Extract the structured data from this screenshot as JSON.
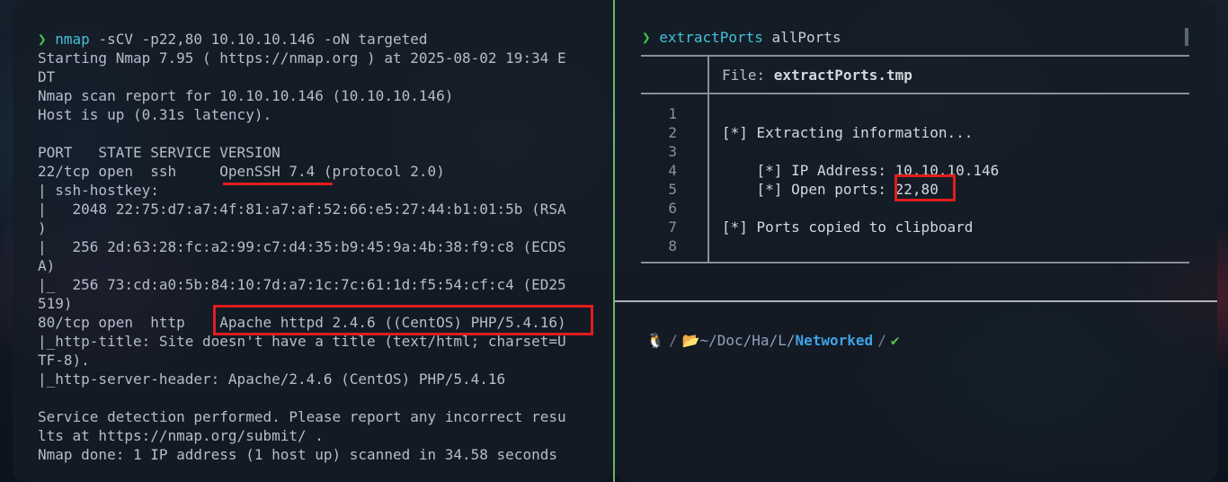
{
  "left_terminal": {
    "prompt_symbol": "❯",
    "command": "nmap",
    "args": " -sCV -p22,80 10.10.10.146 -oN targeted",
    "output_lines": [
      "Starting Nmap 7.95 ( https://nmap.org ) at 2025-08-02 19:34 E",
      "DT",
      "Nmap scan report for 10.10.10.146 (10.10.10.146)",
      "Host is up (0.31s latency).",
      "",
      "PORT   STATE SERVICE VERSION",
      "22/tcp open  ssh     OpenSSH 7.4 (protocol 2.0)",
      "| ssh-hostkey:",
      "|   2048 22:75:d7:a7:4f:81:a7:af:52:66:e5:27:44:b1:01:5b (RSA",
      ")",
      "|   256 2d:63:28:fc:a2:99:c7:d4:35:b9:45:9a:4b:38:f9:c8 (ECDS",
      "A)",
      "|_  256 73:cd:a0:5b:84:10:7d:a7:1c:7c:61:1d:f5:54:cf:c4 (ED25",
      "519)",
      "80/tcp open  http    Apache httpd 2.4.6 ((CentOS) PHP/5.4.16)",
      "|_http-title: Site doesn't have a title (text/html; charset=U",
      "TF-8).",
      "|_http-server-header: Apache/2.4.6 (CentOS) PHP/5.4.16",
      "",
      "Service detection performed. Please report any incorrect resu",
      "lts at https://nmap.org/submit/ .",
      "Nmap done: 1 IP address (1 host up) scanned in 34.58 seconds"
    ]
  },
  "right_terminal": {
    "prompt_symbol": "❯",
    "command": "extractPorts",
    "args": " allPorts",
    "file_label": "File: ",
    "file_name": "extractPorts.tmp",
    "line_numbers": [
      "1",
      "2",
      "3",
      "4",
      "5",
      "6",
      "7",
      "8"
    ],
    "file_lines": [
      "",
      "[*] Extracting information...",
      "",
      "    [*] IP Address: 10.10.10.146",
      "    [*] Open ports: 22,80",
      "",
      "[*] Ports copied to clipboard",
      ""
    ]
  },
  "status_prompt": {
    "os_icon": "🐧",
    "path_icon": "📂",
    "path_parts": [
      "~",
      "/Doc",
      "/Ha",
      "/L/"
    ],
    "path_last": "Networked",
    "status": "✔"
  },
  "colors": {
    "accent_green": "#3ec94a",
    "command_cyan": "#43c1d9",
    "highlight_red": "#e01d1d",
    "path_blue": "#3fa3e6"
  }
}
